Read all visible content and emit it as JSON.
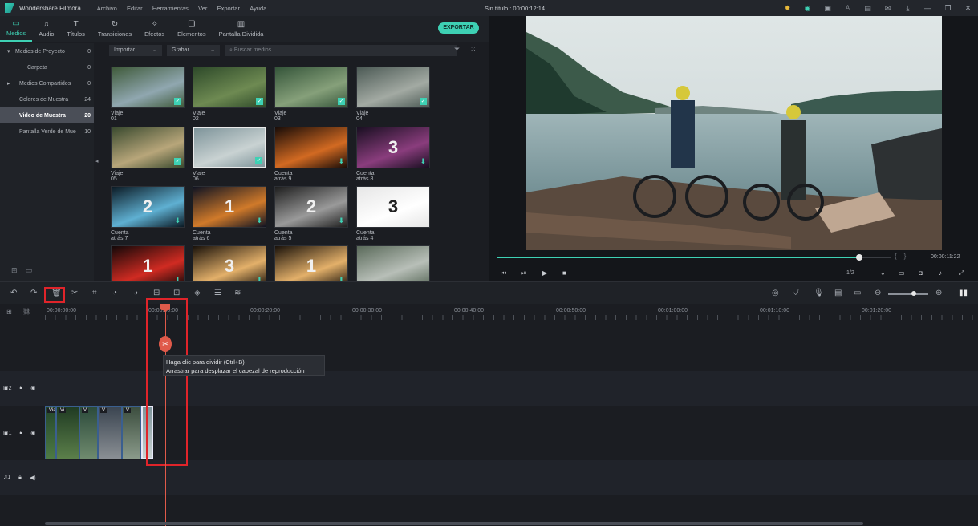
{
  "app": {
    "name": "Wondershare Filmora",
    "window_title": "Sin título : 00:00:12:14"
  },
  "menu": [
    "Archivo",
    "Editar",
    "Herramientas",
    "Ver",
    "Exportar",
    "Ayuda"
  ],
  "tabs": [
    {
      "label": "Medios",
      "icon": "folder-icon",
      "active": true
    },
    {
      "label": "Audio",
      "icon": "music-icon"
    },
    {
      "label": "Títulos",
      "icon": "text-icon"
    },
    {
      "label": "Transiciones",
      "icon": "transition-icon"
    },
    {
      "label": "Efectos",
      "icon": "effects-icon"
    },
    {
      "label": "Elementos",
      "icon": "elements-icon"
    },
    {
      "label": "Pantalla Dividida",
      "icon": "split-screen-icon"
    }
  ],
  "export_label": "EXPORTAR",
  "library": [
    {
      "label": "Medios de Proyecto",
      "count": "0",
      "arrow": "▾"
    },
    {
      "label": "Carpeta",
      "count": "0",
      "arrow": ""
    },
    {
      "label": "Medios Compartidos",
      "count": "0",
      "arrow": "▸"
    },
    {
      "label": "Colores de Muestra",
      "count": "24",
      "arrow": ""
    },
    {
      "label": "Video de Muestra",
      "count": "20",
      "arrow": "",
      "selected": true
    },
    {
      "label": "Pantalla Verde de Mue",
      "count": "10",
      "arrow": ""
    }
  ],
  "media_bar": {
    "import": "Importar",
    "record": "Grabar",
    "search_placeholder": "Buscar medios"
  },
  "media_items": [
    {
      "label": "Viaje 01",
      "colors": [
        "#3f5a3a",
        "#90a7b0"
      ],
      "badge": "check"
    },
    {
      "label": "Viaje 02",
      "colors": [
        "#2e4a2a",
        "#6e8a52"
      ],
      "badge": "check"
    },
    {
      "label": "Viaje 03",
      "colors": [
        "#35553a",
        "#86a07a"
      ],
      "badge": "check"
    },
    {
      "label": "Viaje 04",
      "colors": [
        "#4c5a55",
        "#a3aaa3"
      ],
      "badge": "check"
    },
    {
      "label": "Viaje 05",
      "colors": [
        "#3a4a2f",
        "#b8a67a"
      ],
      "badge": "check"
    },
    {
      "label": "Viaje 06",
      "colors": [
        "#7e949a",
        "#c9d2d2"
      ],
      "badge": "check",
      "selected": true
    },
    {
      "label": "Cuenta atrás 9",
      "colors": [
        "#1a0d08",
        "#d26a22"
      ],
      "badge": "download"
    },
    {
      "label": "Cuenta atrás 8",
      "colors": [
        "#1a0f22",
        "#8a3d7d"
      ],
      "badge": "download",
      "number": "3"
    },
    {
      "label": "Cuenta atrás 7",
      "colors": [
        "#0b1a24",
        "#5fb0d2"
      ],
      "badge": "download",
      "number": "2"
    },
    {
      "label": "Cuenta atrás 6",
      "colors": [
        "#0f1322",
        "#d07a2a"
      ],
      "badge": "download",
      "number": "1"
    },
    {
      "label": "Cuenta atrás 5",
      "colors": [
        "#1e1e1e",
        "#9a9a9a"
      ],
      "badge": "download",
      "number": "2"
    },
    {
      "label": "Cuenta atrás 4",
      "colors": [
        "#e6e6e6",
        "#ffffff"
      ],
      "badge": "none",
      "number": "3"
    },
    {
      "label": "",
      "colors": [
        "#120808",
        "#d02b22"
      ],
      "badge": "download",
      "number": "1"
    },
    {
      "label": "",
      "colors": [
        "#1a120a",
        "#e3b06a"
      ],
      "badge": "download",
      "number": "3"
    },
    {
      "label": "",
      "colors": [
        "#1a120a",
        "#e3b06a"
      ],
      "badge": "download",
      "number": "1"
    },
    {
      "label": "",
      "colors": [
        "#5a6a5a",
        "#b8bfb8"
      ],
      "badge": "none"
    }
  ],
  "preview": {
    "time": "00:00:11:22",
    "ratio": "1/2",
    "progress": 0.92
  },
  "ruler": [
    "00:00:00:00",
    "00:00:10:00",
    "00:00:20:00",
    "00:00:30:00",
    "00:00:40:00",
    "00:00:50:00",
    "00:01:00:00",
    "00:01:10:00",
    "00:01:20:00"
  ],
  "tooltip": {
    "line1": "Haga clic para dividir (Ctrl+B)",
    "line2": "Arrastrar para desplazar el cabezal de reproducción"
  },
  "tracks": [
    {
      "label": "2",
      "icon": "video-track-icon"
    },
    {
      "label": "1",
      "icon": "video-track-icon"
    },
    {
      "label": "1",
      "icon": "audio-track-icon"
    }
  ],
  "clips": [
    {
      "title": "Viaje",
      "colors": [
        "#23452a",
        "#4d7a44"
      ]
    },
    {
      "title": "Vi",
      "colors": [
        "#1f3a22",
        "#5b7f4a"
      ]
    },
    {
      "title": "V",
      "colors": [
        "#2b4a3a",
        "#6f8a6e"
      ]
    },
    {
      "title": "V",
      "colors": [
        "#3a4450",
        "#8a8f94"
      ]
    },
    {
      "title": "V",
      "colors": [
        "#3b4d3e",
        "#8a9a8a"
      ]
    },
    {
      "title": "",
      "colors": [
        "#7e949a",
        "#c9d2d2"
      ]
    }
  ],
  "accent": "#3ed1b4",
  "highlight": "#e0242a"
}
